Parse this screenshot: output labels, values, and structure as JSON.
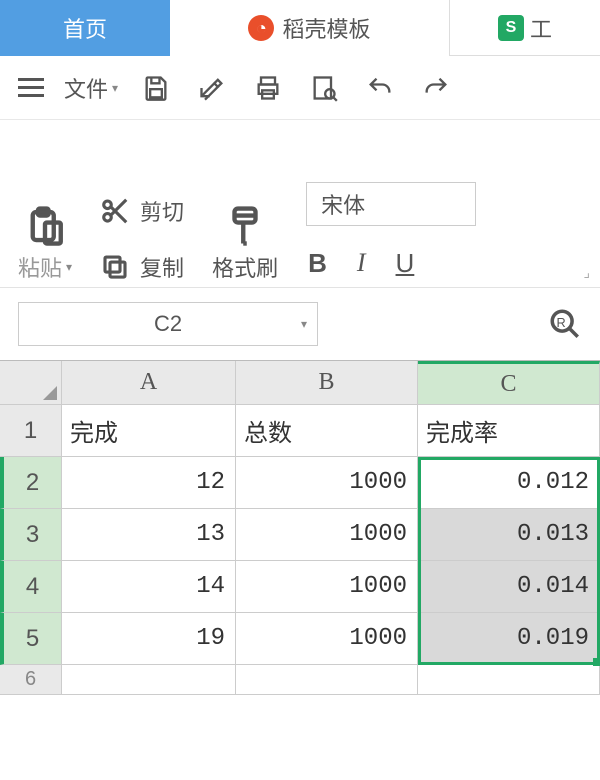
{
  "tabs": {
    "home": "首页",
    "docer": "稻壳模板",
    "sheet": "工"
  },
  "menubar": {
    "file": "文件"
  },
  "ribbon": {
    "paste": "粘贴",
    "cut": "剪切",
    "copy": "复制",
    "format_painter": "格式刷",
    "font_name": "宋体",
    "bold": "B",
    "italic": "I",
    "underline": "U"
  },
  "namebox": {
    "value": "C2"
  },
  "grid": {
    "columns": [
      "A",
      "B",
      "C"
    ],
    "rows": [
      "1",
      "2",
      "3",
      "4",
      "5",
      "6"
    ],
    "headers": {
      "A": "完成",
      "B": "总数",
      "C": "完成率"
    },
    "data": [
      {
        "A": "12",
        "B": "1000",
        "C": "0.012"
      },
      {
        "A": "13",
        "B": "1000",
        "C": "0.013"
      },
      {
        "A": "14",
        "B": "1000",
        "C": "0.014"
      },
      {
        "A": "19",
        "B": "1000",
        "C": "0.019"
      }
    ],
    "selection": {
      "active_cell": "C2",
      "range": "C2:C5"
    }
  },
  "colors": {
    "accent": "#22a864",
    "tab_active": "#529ee2"
  }
}
